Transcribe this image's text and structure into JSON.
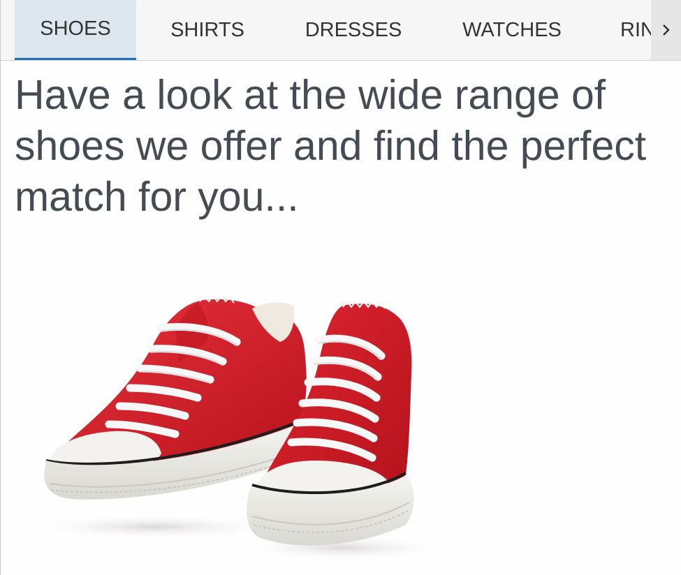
{
  "tabs": [
    {
      "label": "SHOES",
      "selected": true
    },
    {
      "label": "SHIRTS",
      "selected": false
    },
    {
      "label": "DRESSES",
      "selected": false
    },
    {
      "label": "WATCHES",
      "selected": false
    },
    {
      "label": "RIN",
      "selected": false
    }
  ],
  "tab_scroll_icon": "chevron-right-icon",
  "headline": "Have a look at the wide range of shoes we offer and find the perfect match for you...",
  "product_image": {
    "subject": "pair of red canvas sneakers",
    "colors": {
      "canvas": "#d8202a",
      "sole": "#eeeeea",
      "lace": "#f7f7f7",
      "stripe": "#222222"
    }
  },
  "accent_color": "#1f6db4",
  "selected_tab_bg": "#dde7f0"
}
